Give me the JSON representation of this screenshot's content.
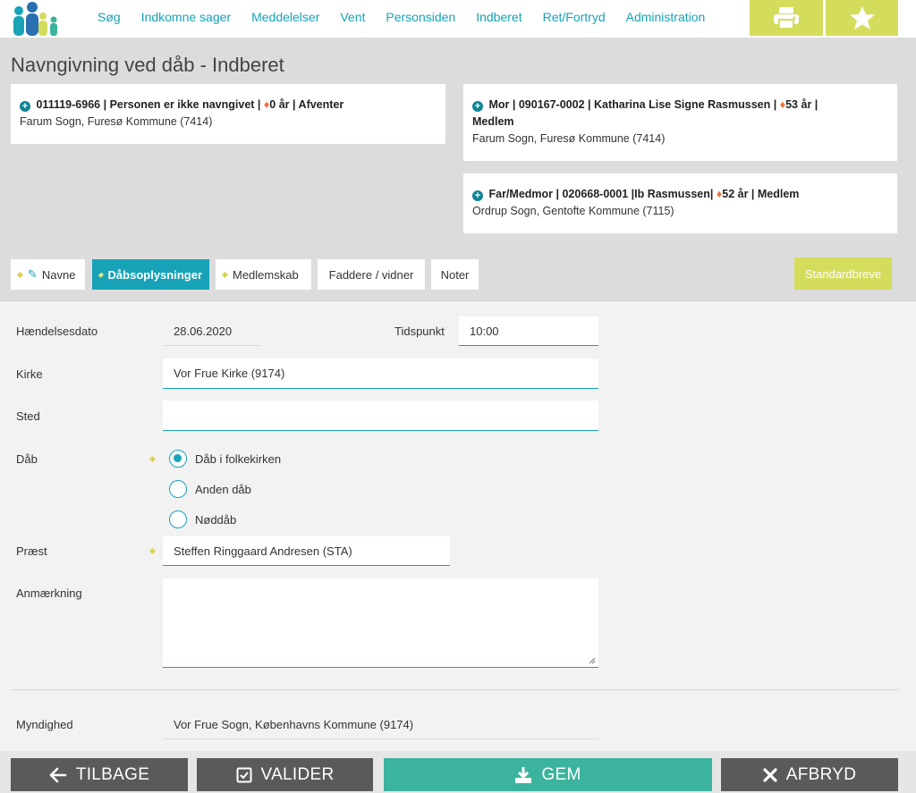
{
  "nav": {
    "links": [
      "Søg",
      "Indkomne sager",
      "Meddelelser",
      "Vent",
      "Personsiden",
      "Indberet",
      "Ret/Fortryd",
      "Administration"
    ]
  },
  "page": {
    "title": "Navngivning ved dåb - Indberet"
  },
  "child_card": {
    "line1_bold": "011119-6966",
    "line1_rest": "| Personen er ikke navngivet |",
    "age": "0 år",
    "status": "| Afventer",
    "line2": "Farum Sogn, Furesø Kommune (7414)"
  },
  "mother_card": {
    "line1": "Mor | 090167-0002 |  Katharina Lise Signe Rasmussen  |",
    "age": "53 år |",
    "line2": "Medlem",
    "line3": "Farum Sogn, Furesø Kommune (7414)"
  },
  "father_card": {
    "line1": "Far/Medmor | 020668-0001 |Ib Rasmussen|",
    "age": "52 år | Medlem",
    "line2": "Ordrup Sogn, Gentofte Kommune (7115)"
  },
  "tabs": [
    "Navne",
    "Dåbsoplysninger",
    "Medlemskab",
    "Faddere / vidner",
    "Noter"
  ],
  "standardbreve_label": "Standardbreve",
  "form": {
    "haendelsesdato_label": "Hændelsesdato",
    "haendelsesdato_value": "28.06.2020",
    "tidspunkt_label": "Tidspunkt",
    "tidspunkt_value": "10:00",
    "kirke_label": "Kirke",
    "kirke_value": "Vor Frue Kirke (9174)",
    "sted_label": "Sted",
    "sted_value": "",
    "daab_label": "Dåb",
    "daab_options": [
      "Dåb i folkekirken",
      "Anden dåb",
      "Nøddåb"
    ],
    "daab_selected": "Dåb i folkekirken",
    "praest_label": "Præst",
    "praest_value": "Steffen Ringgaard Andresen (STA)",
    "anmaerkning_label": "Anmærkning",
    "anmaerkning_value": "",
    "myndighed_label": "Myndighed",
    "myndighed_value": "Vor Frue Sogn, Københavns Kommune (9174)"
  },
  "footer": {
    "back": "TILBAGE",
    "validate": "VALIDER",
    "save": "GEM",
    "cancel": "AFBRYD"
  },
  "colors": {
    "accent": "#17a2b8",
    "lime": "#d4dc5c",
    "save_green": "#3cb39c",
    "dark_button": "#5a5a5a"
  }
}
